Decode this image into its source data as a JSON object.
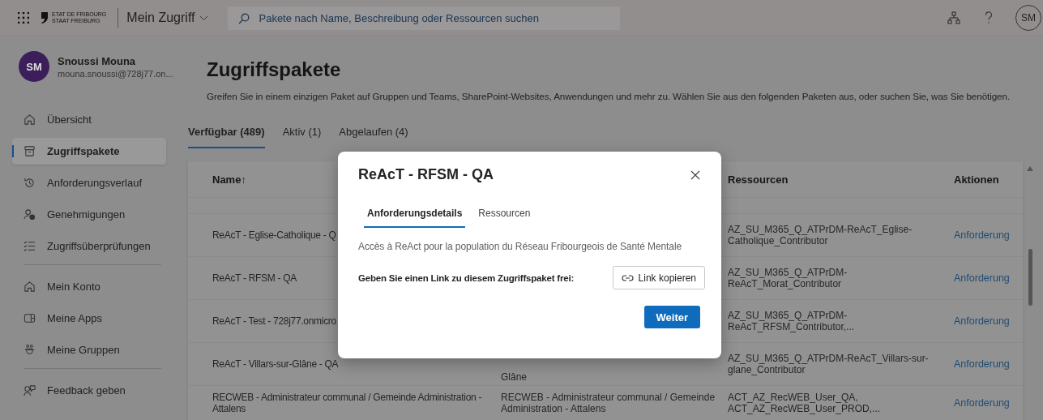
{
  "top_bar": {
    "logo_lines": [
      "ETAT DE FRIBOURG",
      "STAAT FREIBURG"
    ],
    "app_name": "Mein Zugriff",
    "search": {
      "placeholder": "Pakete nach Name, Beschreibung oder Ressourcen suchen"
    },
    "avatar": "SM"
  },
  "profile": {
    "initials": "SM",
    "name": "Snoussi Mouna",
    "email": "mouna.snoussi@728j77.on..."
  },
  "sidebar": {
    "groups": [
      {
        "items": [
          {
            "label": "Übersicht",
            "selected": false
          },
          {
            "label": "Zugriffspakete",
            "selected": true
          },
          {
            "label": "Anforderungsverlauf",
            "selected": false
          },
          {
            "label": "Genehmigungen",
            "selected": false
          },
          {
            "label": "Zugriffsüberprüfungen",
            "selected": false
          }
        ]
      },
      {
        "items": [
          {
            "label": "Mein Konto",
            "selected": false
          },
          {
            "label": "Meine Apps",
            "selected": false
          },
          {
            "label": "Meine Gruppen",
            "selected": false
          }
        ]
      },
      {
        "items": [
          {
            "label": "Feedback geben",
            "selected": false
          }
        ]
      }
    ]
  },
  "page": {
    "title": "Zugriffspakete",
    "subtitle": "Greifen Sie in einem einzigen Paket auf Gruppen und Teams, SharePoint-Websites, Anwendungen und mehr zu. Wählen Sie aus den folgenden Paketen aus, oder suchen Sie, was Sie benötigen."
  },
  "tabs": [
    {
      "label": "Verfügbar (489)",
      "selected": true
    },
    {
      "label": "Aktiv (1)",
      "selected": false
    },
    {
      "label": "Abgelaufen (4)",
      "selected": false
    }
  ],
  "table": {
    "columns": [
      {
        "label": "Name",
        "sort_arrow": "↑"
      },
      {
        "label": "Ressourcen"
      },
      {
        "label": "Aktionen"
      }
    ],
    "rows": [
      {
        "name": "ReAcT - Eglise-Catholique - Q",
        "resources": "AZ_SU_M365_Q_ATPrDM-ReAcT_Eglise-Catholique_Contributor",
        "action": "Anforderung"
      },
      {
        "name": "ReAcT - RFSM - QA",
        "resources": "AZ_SU_M365_Q_ATPrDM-ReAcT_Morat_Contributor",
        "action": "Anforderung"
      },
      {
        "name": "ReAcT - Test - 728j77.onmicro",
        "resources": "AZ_SU_M365_Q_ATPrDM-ReAcT_RFSM_Contributor,...",
        "action": "Anforderung"
      },
      {
        "name": "ReAcT - Villars-sur-Glâne - QA",
        "description": "Glâne",
        "resources": "AZ_SU_M365_Q_ATPrDM-ReAcT_Villars-sur-glane_Contributor",
        "action": "Anforderung"
      },
      {
        "name": "RECWEB - Administrateur communal / Gemeinde Administration - Attalens",
        "description": "RECWEB - Administrateur communal / Gemeinde Administration - Attalens",
        "resources": "ACT_AZ_RecWEB_User_QA, ACT_AZ_RecWEB_User_PROD,...",
        "action": "Anforderung"
      }
    ]
  },
  "dialog": {
    "title": "ReAcT - RFSM - QA",
    "tabs": [
      {
        "label": "Anforderungsdetails",
        "selected": true
      },
      {
        "label": "Ressourcen",
        "selected": false
      }
    ],
    "description": "Accès à ReAct pour la population du Réseau Fribourgeois de Santé Mentale",
    "share_label": "Geben Sie einen Link zu diesem Zugriffspaket frei:",
    "copy_button": "Link kopieren",
    "primary_button": "Weiter"
  }
}
